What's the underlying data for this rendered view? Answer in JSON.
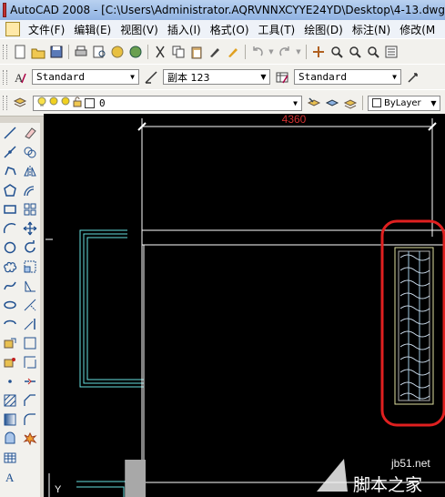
{
  "window": {
    "title": "AutoCAD 2008 - [C:\\Users\\Administrator.AQRVNNXCYYE24YD\\Desktop\\4-13.dwg"
  },
  "menu": [
    "文件(F)",
    "编辑(E)",
    "视图(V)",
    "插入(I)",
    "格式(O)",
    "工具(T)",
    "绘图(D)",
    "标注(N)",
    "修改(M"
  ],
  "styles_toolbar": {
    "text_style": "Standard",
    "dim_style": "副本 123",
    "table_style": "Standard"
  },
  "layers_toolbar": {
    "current_layer": "0",
    "linetype": "ByLayer"
  },
  "drawing": {
    "dimension_value": "4360",
    "ucs_label": "Y",
    "colors": {
      "background": "#000000",
      "dimension": "#d03030",
      "geometry": "#ffffff",
      "cyan": "#66e0e0",
      "highlight": "#e02020"
    }
  },
  "watermark": {
    "site": "jb51.net",
    "name": "脚本之家"
  }
}
